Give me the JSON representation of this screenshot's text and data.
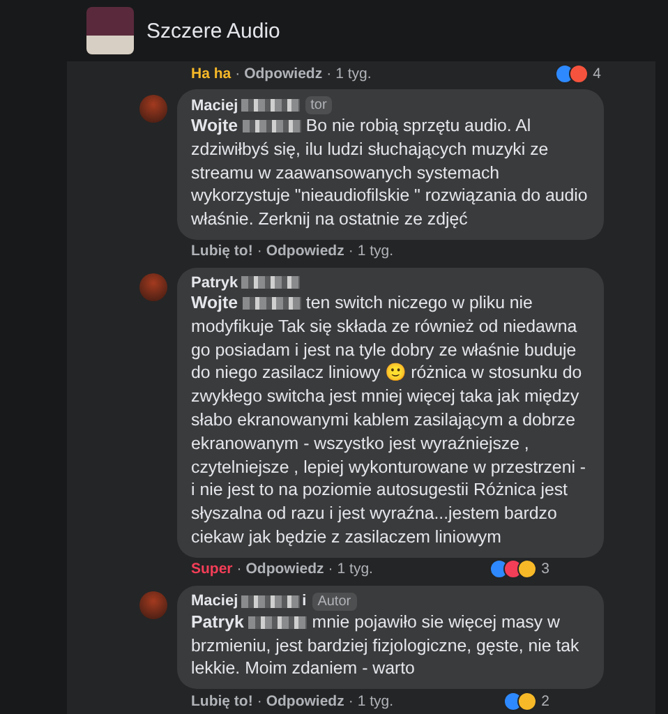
{
  "page": {
    "title": "Szczere Audio"
  },
  "first_footer": {
    "reaction_label": "Ha ha",
    "color": "#f7b928",
    "separator": "·",
    "reply": "Odpowiedz",
    "time": "1 tyg.",
    "reactions": [
      {
        "color": "#2e89ff"
      },
      {
        "color": "#f5533d"
      }
    ],
    "reaction_count": "4"
  },
  "comments": [
    {
      "author": "Maciej",
      "badge": "tor",
      "mention": "Wojte",
      "body": "Bo nie robią sprzętu audio. Al zdziwiłbyś się, ilu ludzi słuchających muzyki ze streamu w zaawansowanych systemach wykorzystuje \"nieaudiofilskie \" rozwiązania do audio właśnie. Zerknij na ostatnie ze zdjęć",
      "reaction_label": "Lubię to!",
      "color": "#b0b3b8",
      "separator": "·",
      "reply": "Odpowiedz",
      "time": "1 tyg."
    },
    {
      "author": "Patryk",
      "mention": "Wojte",
      "body": "ten switch niczego w pliku nie modyfikuje Tak się składa ze również od niedawna go posiadam i jest na tyle dobry ze właśnie buduje do niego zasilacz liniowy 🙂 różnica w stosunku do zwykłego switcha jest mniej więcej taka jak między słabo ekranowanymi kablem zasilającym a dobrze ekranowanym - wszystko jest wyraźniejsze , czytelniejsze , lepiej wykonturowane w przestrzeni - i nie jest to na poziomie autosugestii Różnica jest słyszalna od razu i jest wyraźna...jestem bardzo ciekaw jak będzie z zasilaczem liniowym",
      "reaction_label": "Super",
      "color": "#f33e58",
      "separator": "·",
      "reply": "Odpowiedz",
      "time": "1 tyg.",
      "reactions": [
        {
          "color": "#2e89ff"
        },
        {
          "color": "#f33e58"
        },
        {
          "color": "#f7b928"
        }
      ],
      "reaction_count": "3"
    },
    {
      "author": "Maciej",
      "author_suffix": "i",
      "badge": "Autor",
      "mention": "Patryk",
      "body": "mnie pojawiło sie więcej masy w brzmieniu, jest bardziej fizjologiczne, gęste, nie tak lekkie. Moim zdaniem - warto",
      "reaction_label": "Lubię to!",
      "color": "#b0b3b8",
      "separator": "·",
      "reply": "Odpowiedz",
      "time": "1 tyg.",
      "reactions": [
        {
          "color": "#2e89ff"
        },
        {
          "color": "#f7b928"
        }
      ],
      "reaction_count": "2"
    }
  ]
}
